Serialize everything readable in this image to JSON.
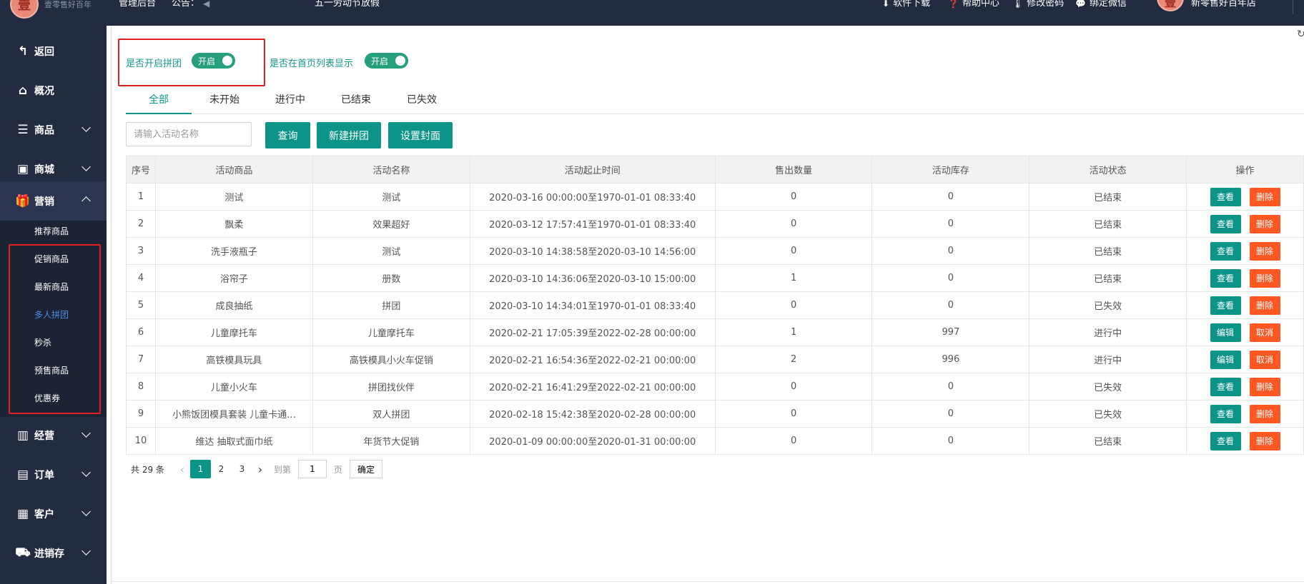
{
  "topbar": {
    "logo_char": "壹",
    "logo_text": "壹零售好百年",
    "admin": "管理后台",
    "notice_label": "公告：",
    "notice_text": "五一劳动节放假",
    "download": "软件下载",
    "help": "帮助中心",
    "change_password": "修改密码",
    "bind_wechat": "绑定微信",
    "avatar_char": "壹",
    "store_name": "新零售好百年店"
  },
  "sidebar": {
    "items": [
      {
        "label": "返回",
        "icon": "back-arrow-icon"
      },
      {
        "label": "概况",
        "icon": "home-icon"
      },
      {
        "label": "商品",
        "icon": "list-icon"
      },
      {
        "label": "商城",
        "icon": "shopping-bag-icon"
      },
      {
        "label": "营销",
        "icon": "gift-icon"
      },
      {
        "label": "经营",
        "icon": "bar-chart-icon"
      },
      {
        "label": "订单",
        "icon": "order-list-icon"
      },
      {
        "label": "客户",
        "icon": "id-card-icon"
      },
      {
        "label": "进销存",
        "icon": "truck-icon"
      }
    ],
    "submenu": [
      "推荐商品",
      "促销商品",
      "最新商品",
      "多人拼团",
      "秒杀",
      "预售商品",
      "优惠券"
    ]
  },
  "toggles": {
    "group_buy_label": "是否开启拼团",
    "group_buy_state": "开启",
    "homepage_label": "是否在首页列表显示",
    "homepage_state": "开启"
  },
  "tabs": [
    "全部",
    "未开始",
    "进行中",
    "已结束",
    "已失效"
  ],
  "toolbar": {
    "search_placeholder": "请输入活动名称",
    "query": "查询",
    "new_group": "新建拼团",
    "set_cover": "设置封面"
  },
  "table": {
    "headers": [
      "序号",
      "活动商品",
      "活动名称",
      "活动起止时间",
      "售出数量",
      "活动库存",
      "活动状态",
      "操作"
    ],
    "rows": [
      {
        "no": "1",
        "product": "测试",
        "name": "测试",
        "time": "2020-03-16 00:00:00至1970-01-01 08:33:40",
        "sold": "0",
        "stock": "0",
        "status": "已结束",
        "a1": "查看",
        "a2": "删除"
      },
      {
        "no": "2",
        "product": "飘柔",
        "name": "效果超好",
        "time": "2020-03-12 17:57:41至1970-01-01 08:33:40",
        "sold": "0",
        "stock": "0",
        "status": "已结束",
        "a1": "查看",
        "a2": "删除"
      },
      {
        "no": "3",
        "product": "洗手液瓶子",
        "name": "测试",
        "time": "2020-03-10 14:38:58至2020-03-10 14:56:00",
        "sold": "0",
        "stock": "0",
        "status": "已结束",
        "a1": "查看",
        "a2": "删除"
      },
      {
        "no": "4",
        "product": "浴帘子",
        "name": "册数",
        "time": "2020-03-10 14:36:06至2020-03-10 15:00:00",
        "sold": "1",
        "stock": "0",
        "status": "已结束",
        "a1": "查看",
        "a2": "删除"
      },
      {
        "no": "5",
        "product": "成良抽纸",
        "name": "拼团",
        "time": "2020-03-10 14:34:01至1970-01-01 08:33:40",
        "sold": "0",
        "stock": "0",
        "status": "已失效",
        "a1": "查看",
        "a2": "删除"
      },
      {
        "no": "6",
        "product": "儿童摩托车",
        "name": "儿童摩托车",
        "time": "2020-02-21 17:05:39至2022-02-28 00:00:00",
        "sold": "1",
        "stock": "997",
        "status": "进行中",
        "a1": "编辑",
        "a2": "取消"
      },
      {
        "no": "7",
        "product": "高铁模具玩具",
        "name": "高铁模具小火车促销",
        "time": "2020-02-21 16:54:36至2022-02-21 00:00:00",
        "sold": "2",
        "stock": "996",
        "status": "进行中",
        "a1": "编辑",
        "a2": "取消"
      },
      {
        "no": "8",
        "product": "儿童小火车",
        "name": "拼团找伙伴",
        "time": "2020-02-21 16:41:29至2022-02-21 00:00:00",
        "sold": "0",
        "stock": "0",
        "status": "已失效",
        "a1": "查看",
        "a2": "删除"
      },
      {
        "no": "9",
        "product": "小熊饭团模具套装 儿童卡通...",
        "name": "双人拼团",
        "time": "2020-02-18 15:42:38至2020-02-28 00:00:00",
        "sold": "0",
        "stock": "0",
        "status": "已失效",
        "a1": "查看",
        "a2": "删除"
      },
      {
        "no": "10",
        "product": "维达 抽取式面巾纸",
        "name": "年货节大促销",
        "time": "2020-01-09 00:00:00至2020-01-31 00:00:00",
        "sold": "0",
        "stock": "0",
        "status": "已结束",
        "a1": "查看",
        "a2": "删除"
      }
    ]
  },
  "pagination": {
    "total": "共 29 条",
    "pages": [
      "1",
      "2",
      "3"
    ],
    "goto": "到第",
    "input_value": "1",
    "page_unit": "页",
    "confirm": "确定"
  },
  "colors": {
    "sidebar_bg": "#232b41",
    "primary": "#0d9488",
    "danger": "#ff5722",
    "highlight_box": "#e02020"
  }
}
